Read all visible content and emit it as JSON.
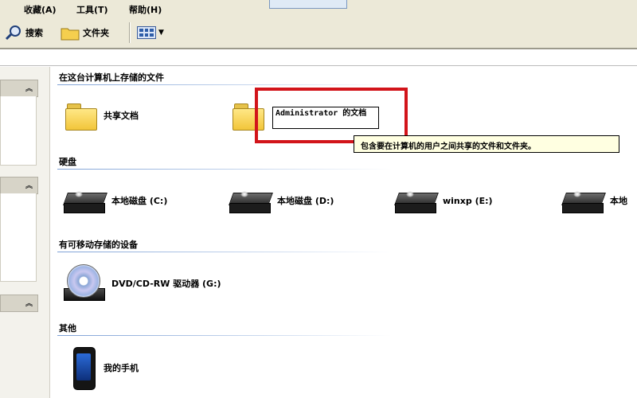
{
  "menu": {
    "items": [
      {
        "label": "收藏(A)"
      },
      {
        "label": "工具(T)"
      },
      {
        "label": "帮助(H)"
      }
    ]
  },
  "toolbar": {
    "search_label": "搜索",
    "folders_label": "文件夹"
  },
  "sections": {
    "stored_files": "在这台计算机上存储的文件",
    "hard_drives": "硬盘",
    "removable": "有可移动存储的设备",
    "other": "其他"
  },
  "files": {
    "shared_docs": "共享文档",
    "admin_docs_rename_value": "Administrator 的文档"
  },
  "tooltip": {
    "text": "包含要在计算机的用户之间共享的文件和文件夹。"
  },
  "drives": [
    {
      "label": "本地磁盘 (C:)"
    },
    {
      "label": "本地磁盘 (D:)"
    },
    {
      "label": "winxp (E:)"
    },
    {
      "label": "本地"
    }
  ],
  "devices": [
    {
      "label": "DVD/CD-RW 驱动器 (G:)"
    }
  ],
  "other_items": [
    {
      "label": "我的手机"
    }
  ],
  "colors": {
    "highlight_border": "#d2141a",
    "tooltip_bg": "#ffffe1",
    "chrome_bg": "#ece9d8"
  }
}
